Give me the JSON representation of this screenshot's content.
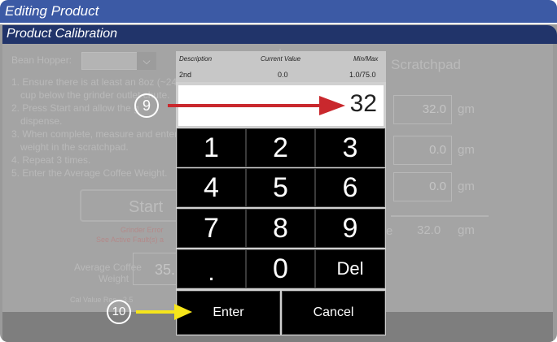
{
  "header": {
    "title": "Editing Product",
    "subtitle": "Product Calibration"
  },
  "left_panel": {
    "bean_hopper_label": "Bean Hopper:",
    "instructions": [
      "1. Ensure there is at least an 8oz (~240",
      "cup below the grinder outlet chute.",
      "2. Press Start and allow the g",
      "dispense.",
      "3. When complete, measure and enter",
      "weight in the scratchpad.",
      "4. Repeat 3 times.",
      "5. Enter the Average Coffee Weight."
    ],
    "start_label": "Start",
    "grinder_error": "Grinder Error",
    "see_active": "See Active Fault(s) a",
    "avg_label_1": "Average Coffee",
    "avg_label_2": "Weight",
    "avg_value": "35.",
    "cal_note": "Cal Value Res - 3.5"
  },
  "scratchpad": {
    "title": "Scratchpad",
    "values": [
      "32.0",
      "0.0",
      "0.0"
    ],
    "unit": "gm",
    "avg_prefix": "e",
    "average": "32.0",
    "average_unit": "gm"
  },
  "keypad": {
    "header": {
      "description_label": "Description",
      "current_label": "Current Value",
      "minmax_label": "Min/Max"
    },
    "description_value": "2nd",
    "current_value": "0.0",
    "minmax_value": "1.0/75.0",
    "entry": "32",
    "keys": [
      "1",
      "2",
      "3",
      "4",
      "5",
      "6",
      "7",
      "8",
      "9",
      ".",
      "0",
      "Del"
    ],
    "enter_label": "Enter",
    "cancel_label": "Cancel"
  },
  "annotations": {
    "step9": "9",
    "step10": "10"
  },
  "colors": {
    "title_bar": "#3c5aa5",
    "sub_bar": "#21346a",
    "arrow_red": "#c9282d",
    "arrow_yellow": "#f6e51a",
    "key_bg": "#000000"
  }
}
